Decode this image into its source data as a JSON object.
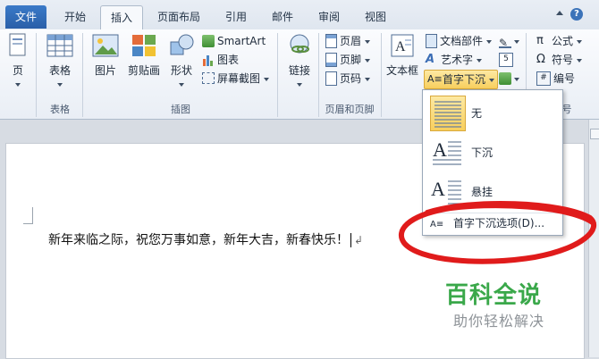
{
  "tabs": [
    {
      "id": "file",
      "label": "文件"
    },
    {
      "id": "home",
      "label": "开始"
    },
    {
      "id": "insert",
      "label": "插入",
      "active": true
    },
    {
      "id": "layout",
      "label": "页面布局"
    },
    {
      "id": "references",
      "label": "引用"
    },
    {
      "id": "mailings",
      "label": "邮件"
    },
    {
      "id": "review",
      "label": "审阅"
    },
    {
      "id": "view",
      "label": "视图"
    }
  ],
  "ribbon": {
    "pages": {
      "label": "页"
    },
    "table": {
      "label": "表格",
      "group": "表格"
    },
    "illustrations": {
      "group": "插图",
      "picture": "图片",
      "clipart": "剪贴画",
      "shapes": "形状",
      "smartart": "SmartArt",
      "chart": "图表",
      "screenshot": "屏幕截图"
    },
    "links": {
      "label": "链接"
    },
    "header_footer": {
      "group": "页眉和页脚",
      "header": "页眉",
      "footer": "页脚",
      "page_number": "页码"
    },
    "text": {
      "textbox": "文本框",
      "quick_parts": "文档部件",
      "wordart": "艺术字",
      "dropcap": "首字下沉"
    },
    "symbols": {
      "group_partial": "号",
      "equation": "公式",
      "symbol": "符号",
      "numbering": "编号"
    }
  },
  "dropcap_menu": {
    "items": [
      {
        "id": "none",
        "label": "无",
        "selected": true
      },
      {
        "id": "dropped",
        "label": "下沉"
      },
      {
        "id": "in_margin",
        "label": "悬挂"
      }
    ],
    "options_label": "首字下沉选项(D)..."
  },
  "document": {
    "text": "新年来临之际，祝您万事如意，新年大吉，新春快乐！"
  },
  "watermark": {
    "title": "百科全说",
    "subtitle": "助你轻松解决"
  },
  "colors": {
    "file_tab": "#2a5fa8",
    "highlight": "#f8cf5d",
    "annotation": "#e01b1b",
    "watermark_green": "#3aa84a"
  }
}
